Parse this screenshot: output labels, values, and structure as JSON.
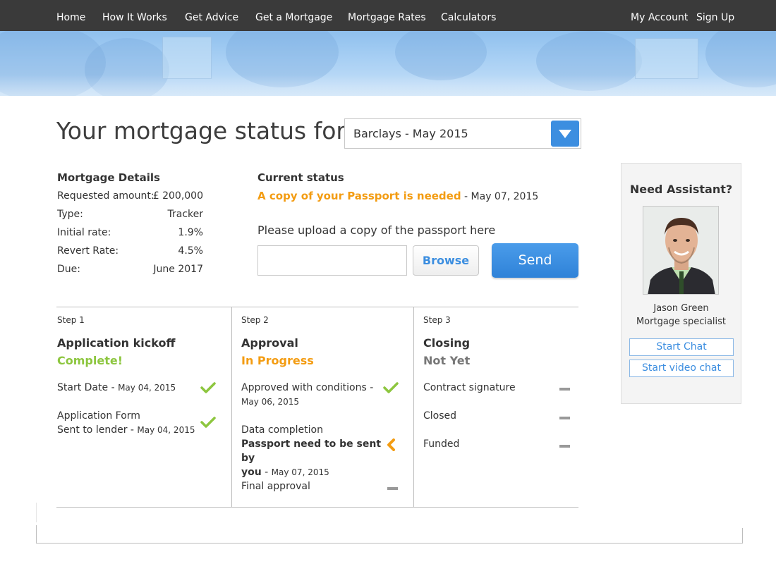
{
  "nav": {
    "left": [
      "Home",
      "How It Works",
      "Get Advice",
      "Get a Mortgage",
      "Mortgage Rates",
      "Calculators"
    ],
    "right": [
      "My Account",
      "Sign Up"
    ]
  },
  "page": {
    "title": "Your mortgage status for",
    "selected_mortgage": "Barclays - May 2015"
  },
  "details": {
    "heading": "Mortgage Details",
    "rows": [
      {
        "label": "Requested amount:",
        "value": "£ 200,000"
      },
      {
        "label": "Type:",
        "value": "Tracker"
      },
      {
        "label": "Initial rate:",
        "value": "1.9%"
      },
      {
        "label": "Revert Rate:",
        "value": "4.5%"
      },
      {
        "label": "Due:",
        "value": "June 2017"
      }
    ]
  },
  "status": {
    "heading": "Current status",
    "message": "A copy of your Passport is needed",
    "separator": " - ",
    "date": "May 07, 2015",
    "upload_label": "Please upload a copy of the passport here",
    "upload_value": "",
    "browse_label": "Browse",
    "send_label": "Send"
  },
  "steps": [
    {
      "number": "Step 1",
      "title": "Application kickoff",
      "state": "Complete!",
      "tasks": [
        {
          "line1": "Start Date",
          "date": "May 04, 2015",
          "icon": "check-icon"
        },
        {
          "line1": "Application Form",
          "line2": "Sent to lender",
          "date": "May 04, 2015",
          "icon": "check-icon"
        }
      ]
    },
    {
      "number": "Step 2",
      "title": "Approval",
      "state": "In Progress",
      "tasks": [
        {
          "line1": "Approved with conditions -",
          "date": "May 06, 2015",
          "icon": "check-icon"
        },
        {
          "line1": "Data completion",
          "line2": "Passport need to be sent by",
          "line3": "you",
          "date": "May 07, 2015",
          "icon": "arrow-left-icon"
        },
        {
          "line1": "Final approval",
          "icon": "dash-icon"
        }
      ]
    },
    {
      "number": "Step 3",
      "title": "Closing",
      "state": "Not Yet",
      "tasks": [
        {
          "line1": "Contract signature",
          "icon": "dash-icon"
        },
        {
          "line1": "Closed",
          "icon": "dash-icon"
        },
        {
          "line1": "Funded",
          "icon": "dash-icon"
        }
      ]
    }
  ],
  "assistant": {
    "heading": "Need Assistant?",
    "name": "Jason Green",
    "role": "Mortgage specialist",
    "chat_label": "Start Chat",
    "video_label": "Start video chat"
  },
  "colors": {
    "nav_bg": "#3a3a3a",
    "accent_blue": "#3c8ee0",
    "complete_green": "#8dc63f",
    "progress_orange": "#f39c12",
    "not_yet_gray": "#777777"
  }
}
